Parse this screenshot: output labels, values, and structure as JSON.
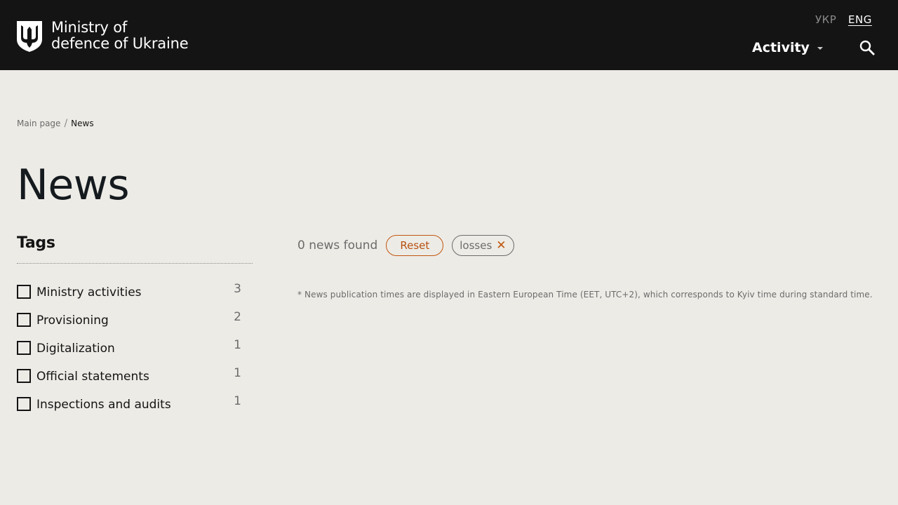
{
  "header": {
    "logo_line1": "Ministry of",
    "logo_line2": "defence of Ukraine",
    "lang_ukr": "УКР",
    "lang_eng": "ENG",
    "nav_activity": "Activity"
  },
  "breadcrumb": {
    "home": "Main page",
    "separator": "/",
    "current": "News"
  },
  "page_title": "News",
  "tags": {
    "title": "Tags",
    "items": [
      {
        "label": "Ministry activities",
        "count": "3"
      },
      {
        "label": "Provisioning",
        "count": "2"
      },
      {
        "label": "Digitalization",
        "count": "1"
      },
      {
        "label": "Official statements",
        "count": "1"
      },
      {
        "label": "Inspections and audits",
        "count": "1"
      }
    ]
  },
  "results": {
    "found_text": "0 news found",
    "reset_label": "Reset",
    "active_filter": "losses",
    "filter_close": "✕"
  },
  "footnote": "* News publication times are displayed in Eastern European Time (EET, UTC+2), which corresponds to Kyiv time during standard time.",
  "colors": {
    "header_bg": "#141414",
    "page_bg": "#edebe6",
    "accent": "#c0570f"
  }
}
